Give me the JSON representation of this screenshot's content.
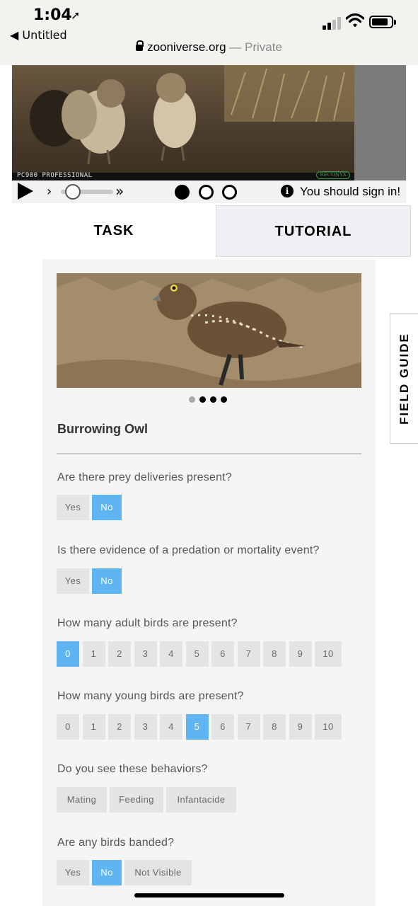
{
  "status_bar": {
    "time": "1:04",
    "back_label": "◀ Untitled",
    "url_domain": "zooniverse.org",
    "url_suffix": " — Private"
  },
  "video": {
    "camera_text": "PC900 PROFESSIONAL",
    "brand_text": "RECONYX",
    "frames_total": 3,
    "frame_current": 1,
    "sign_in_text": "You should sign in!"
  },
  "tabs": {
    "task": "TASK",
    "tutorial": "TUTORIAL"
  },
  "field_guide": "FIELD GUIDE",
  "species": {
    "name": "Burrowing Owl",
    "images_total": 4,
    "image_current": 1
  },
  "questions": [
    {
      "text": "Are there prey deliveries present?",
      "options": [
        "Yes",
        "No"
      ],
      "selected": "No"
    },
    {
      "text": "Is there evidence of a predation or mortality event?",
      "options": [
        "Yes",
        "No"
      ],
      "selected": "No"
    },
    {
      "text": "How many adult birds are present?",
      "options": [
        "0",
        "1",
        "2",
        "3",
        "4",
        "5",
        "6",
        "7",
        "8",
        "9",
        "10"
      ],
      "selected": "0"
    },
    {
      "text": "How many young birds are present?",
      "options": [
        "0",
        "1",
        "2",
        "3",
        "4",
        "5",
        "6",
        "7",
        "8",
        "9",
        "10"
      ],
      "selected": "5"
    },
    {
      "text": "Do you see these behaviors?",
      "options": [
        "Mating",
        "Feeding",
        "Infantacide"
      ],
      "selected": ""
    },
    {
      "text": "Are any birds banded?",
      "options": [
        "Yes",
        "No",
        "Not Visible"
      ],
      "selected": "No"
    }
  ],
  "colors": {
    "selected": "#5eb5f2",
    "option_bg": "#e4e4e4",
    "panel_bg": "#f5f5f5"
  }
}
